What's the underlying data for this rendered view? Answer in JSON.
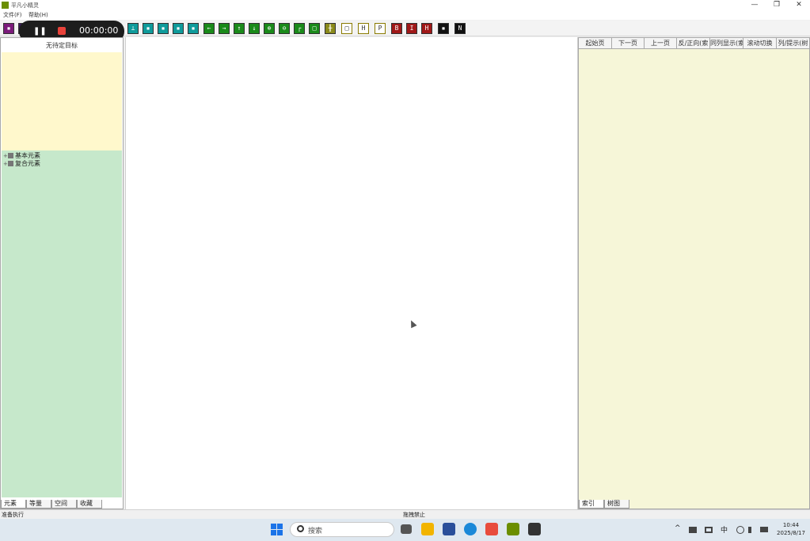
{
  "window": {
    "title": "平凡小精灵",
    "controls": {
      "minimize": "—",
      "restore": "❐",
      "close": "✕"
    }
  },
  "menu": [
    {
      "label": "文件(F)"
    },
    {
      "label": "帮助(H)"
    }
  ],
  "recorder": {
    "time": "00:00:00"
  },
  "toolbar": {
    "buttons": [
      {
        "glyph": "▪",
        "color": "#7a1a7a"
      },
      {
        "glyph": "▪",
        "color": "#3a1a5a"
      },
      {
        "glyph": "⊥",
        "color": "#0f9b9b"
      },
      {
        "glyph": "▪",
        "color": "#0f9b9b"
      },
      {
        "glyph": "▪",
        "color": "#0f9b9b"
      },
      {
        "glyph": "▪",
        "color": "#0f9b9b"
      },
      {
        "glyph": "▪",
        "color": "#0f9b9b"
      },
      {
        "glyph": "←",
        "color": "#1a8a1a"
      },
      {
        "glyph": "→",
        "color": "#1a8a1a"
      },
      {
        "glyph": "↑",
        "color": "#1a8a1a"
      },
      {
        "glyph": "↓",
        "color": "#1a8a1a"
      },
      {
        "glyph": "⊕",
        "color": "#1a8a1a"
      },
      {
        "glyph": "⊖",
        "color": "#1a8a1a"
      },
      {
        "glyph": "┌",
        "color": "#1a8a1a"
      },
      {
        "glyph": "□",
        "color": "#1a8a1a"
      },
      {
        "glyph": "╫",
        "color": "#8a8a1a"
      },
      {
        "glyph": "□",
        "color": "#ffffff"
      },
      {
        "glyph": "H",
        "color": "#ffffff"
      },
      {
        "glyph": "P",
        "color": "#ffffff"
      },
      {
        "glyph": "B",
        "color": "#a01818"
      },
      {
        "glyph": "I",
        "color": "#a01818"
      },
      {
        "glyph": "H",
        "color": "#a01818"
      },
      {
        "glyph": "▪",
        "color": "#111111"
      },
      {
        "glyph": "N",
        "color": "#111111"
      }
    ]
  },
  "left_panel": {
    "title": "无待定目标",
    "tree": [
      {
        "label": "基本元素"
      },
      {
        "label": "复合元素"
      }
    ],
    "tabs": [
      {
        "label": "元素"
      },
      {
        "label": "等量"
      },
      {
        "label": "空间"
      },
      {
        "label": "收藏"
      }
    ]
  },
  "right_panel": {
    "columns": [
      {
        "label": "起始页"
      },
      {
        "label": "下一页"
      },
      {
        "label": "上一页"
      },
      {
        "label": "反/正向(索"
      },
      {
        "label": "同列显示(索"
      },
      {
        "label": "滚动切换"
      },
      {
        "label": "列/提示(树"
      }
    ],
    "tabs": [
      {
        "label": "索引"
      },
      {
        "label": "树图"
      }
    ]
  },
  "status": {
    "left": "准备执行",
    "center": "拖拽禁止"
  },
  "taskbar": {
    "search_placeholder": "搜索",
    "tray": {
      "chevron": "^",
      "ime": "中"
    },
    "clock": {
      "time": "10:44",
      "date": "2025/8/17"
    }
  }
}
